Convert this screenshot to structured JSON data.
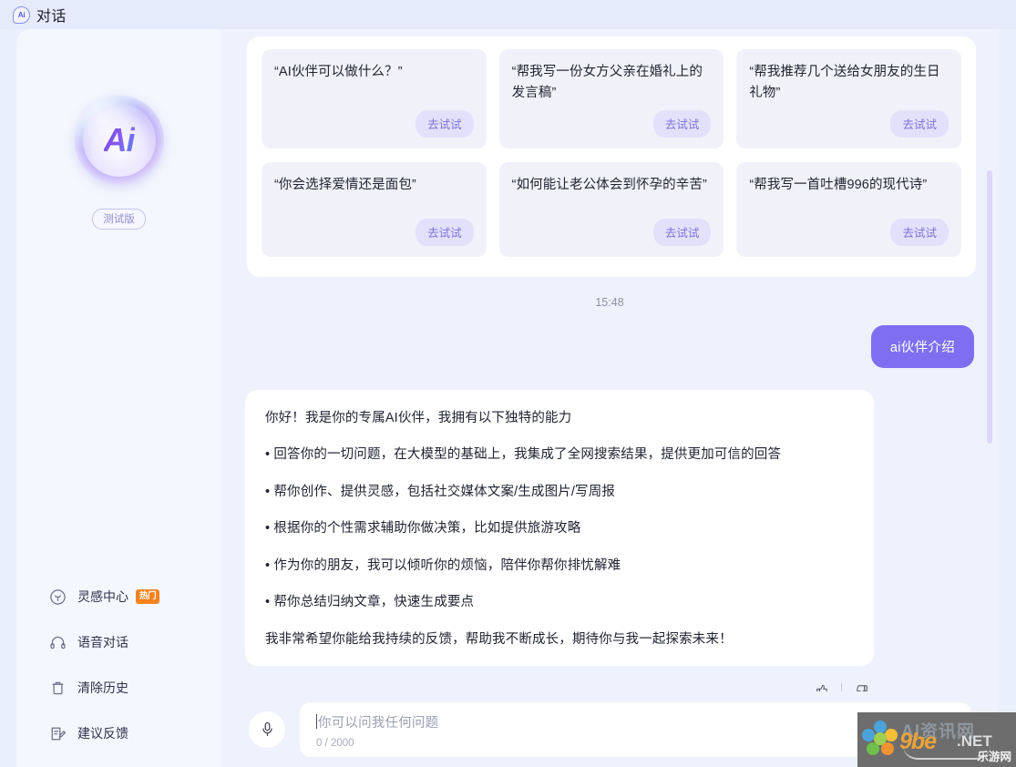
{
  "window": {
    "title": "对话",
    "logo_text": "Ai",
    "logo_icon": "ai-bubble-icon",
    "avatar_icon": "user-avatar-rabbits"
  },
  "sidebar": {
    "brand": {
      "logo_text": "Ai",
      "badge": "测试版"
    },
    "items": [
      {
        "label": "灵感中心",
        "icon": "lightbulb-icon",
        "badge": "热门"
      },
      {
        "label": "语音对话",
        "icon": "headphones-icon",
        "badge": ""
      },
      {
        "label": "清除历史",
        "icon": "trash-icon",
        "badge": ""
      },
      {
        "label": "建议反馈",
        "icon": "edit-note-icon",
        "badge": ""
      }
    ]
  },
  "suggestions": {
    "action_label": "去试试",
    "cards": [
      {
        "text": "“AI伙伴可以做什么？”"
      },
      {
        "text": "“帮我写一份女方父亲在婚礼上的发言稿”"
      },
      {
        "text": "“帮我推荐几个送给女朋友的生日礼物”"
      },
      {
        "text": "“你会选择爱情还是面包”"
      },
      {
        "text": "“如何能让老公体会到怀孕的辛苦”"
      },
      {
        "text": "“帮我写一首吐槽996的现代诗”"
      }
    ]
  },
  "conversation": {
    "timestamp": "15:48",
    "user_message": "ai伙伴介绍",
    "ai_message_lines": [
      "你好！我是你的专属AI伙伴，我拥有以下独特的能力",
      "• 回答你的一切问题，在大模型的基础上，我集成了全网搜索结果，提供更加可信的回答",
      "• 帮你创作、提供灵感，包括社交媒体文案/生成图片/写周报",
      "• 根据你的个性需求辅助你做决策，比如提供旅游攻略",
      "• 作为你的朋友，我可以倾听你的烦恼，陪伴你帮你排忧解难",
      "• 帮你总结归纳文章，快速生成要点",
      "我非常希望你能给我持续的反馈，帮助我不断成长，期待你与我一起探索未来！"
    ],
    "feedback": {
      "like_icon": "thumbs-up-icon",
      "dislike_icon": "thumbs-down-icon"
    }
  },
  "composer": {
    "mic_icon": "microphone-icon",
    "placeholder": "你可以问我任何问题",
    "value": "",
    "counter": "0 / 2000"
  },
  "watermark": {
    "top_text": "AI资讯网",
    "brand": "9be",
    "suffix": ".NET",
    "sub": "乐游网"
  },
  "colors": {
    "page_bg": "#e9effb",
    "panel_bg": "#f4f7fe",
    "chat_bg": "#eef2fd",
    "accent_purple": "#7d6ff0",
    "card_bg": "#f1f2f9",
    "pill_bg": "#e3e0fb",
    "pill_text": "#7b74d8",
    "hot_badge": "#f5821f",
    "scrollbar": "#dcd8f8"
  }
}
